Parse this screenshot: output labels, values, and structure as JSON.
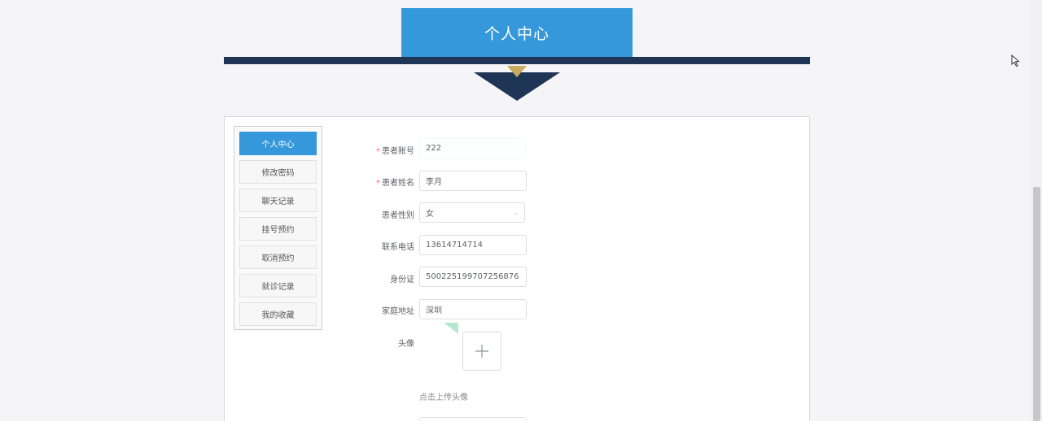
{
  "header": {
    "title": "个人中心"
  },
  "sidebar": {
    "items": [
      {
        "label": "个人中心",
        "active": true
      },
      {
        "label": "修改密码"
      },
      {
        "label": "聊天记录"
      },
      {
        "label": "挂号预约"
      },
      {
        "label": "取消预约"
      },
      {
        "label": "就诊记录"
      },
      {
        "label": "我的收藏"
      }
    ]
  },
  "form": {
    "account": {
      "label": "患者账号",
      "value": "222",
      "required": true
    },
    "name": {
      "label": "患者姓名",
      "value": "李月",
      "required": true
    },
    "gender": {
      "label": "患者性别",
      "value": "女"
    },
    "phone": {
      "label": "联系电话",
      "value": "13614714714"
    },
    "id_card": {
      "label": "身份证",
      "value": "500225199707256876"
    },
    "address": {
      "label": "家庭地址",
      "value": "深圳"
    },
    "avatar": {
      "label": "头像",
      "hint": "点击上传头像",
      "upload_icon": "plus-icon"
    }
  },
  "colors": {
    "primary": "#3498db",
    "navy": "#1f3556",
    "gold": "#c9a95c",
    "required": "#f56c6c"
  }
}
